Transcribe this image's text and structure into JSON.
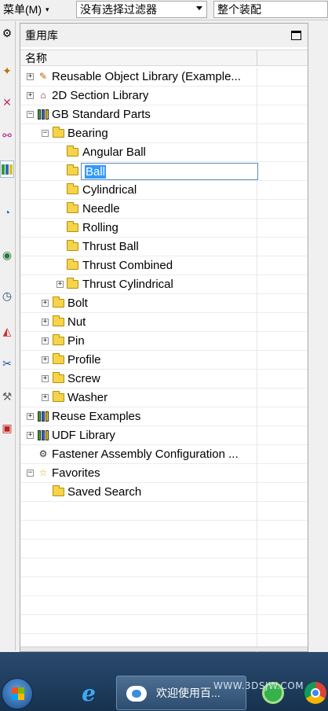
{
  "toolbar": {
    "menu_label": "菜单(M)",
    "menu_caret": "▾",
    "filter_value": "没有选择过滤器",
    "assembly_value": "整个装配"
  },
  "panel": {
    "title": "重用库",
    "column_header": "名称"
  },
  "tree": {
    "reusable": "Reusable Object Library (Example...",
    "section2d": "2D Section Library",
    "gb": "GB Standard Parts",
    "bearing": "Bearing",
    "angular_ball": "Angular Ball",
    "ball": "Ball",
    "cylindrical": "Cylindrical",
    "needle": "Needle",
    "rolling": "Rolling",
    "thrust_ball": "Thrust Ball",
    "thrust_combined": "Thrust Combined",
    "thrust_cylindrical": "Thrust Cylindrical",
    "bolt": "Bolt",
    "nut": "Nut",
    "pin": "Pin",
    "profile": "Profile",
    "screw": "Screw",
    "washer": "Washer",
    "reuse_examples": "Reuse Examples",
    "udf_library": "UDF Library",
    "fastener": "Fastener Assembly Configuration ...",
    "favorites": "Favorites",
    "saved_search": "Saved Search"
  },
  "taskbar": {
    "baidu_label": "欢迎使用百...",
    "watermark": "WWW.3DSJW.COM"
  },
  "colors": {
    "selection": "#3399ff",
    "folder": "#f5d34a",
    "taskbar": "#1f3d5e"
  }
}
